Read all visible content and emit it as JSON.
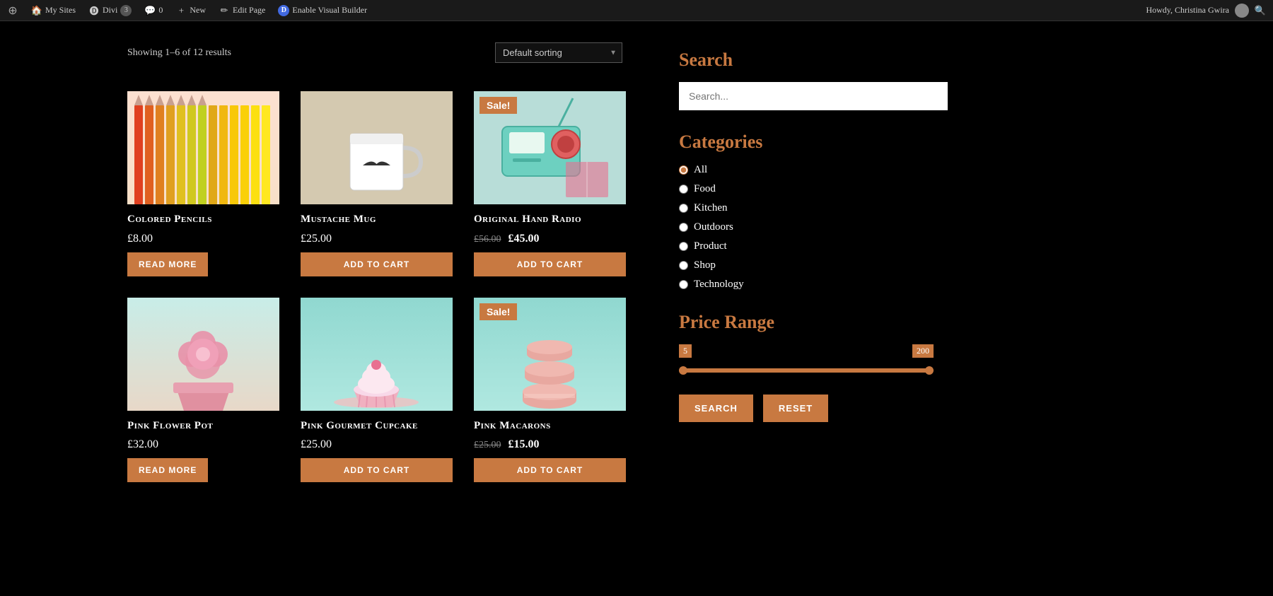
{
  "topbar": {
    "wp_label": "My Sites",
    "divi_label": "Divi",
    "divi_count": "3",
    "comments_count": "0",
    "new_label": "New",
    "edit_label": "Edit Page",
    "divi_builder_label": "Enable Visual Builder",
    "user_label": "Howdy, Christina Gwira"
  },
  "products": {
    "showing_text": "Showing 1–6 of 12 results",
    "sort_label": "Default sorting",
    "items": [
      {
        "id": "colored-pencils",
        "title": "Colored Pencils",
        "price": "£8.00",
        "original_price": null,
        "sale": false,
        "button": "READ MORE",
        "button_type": "readmore"
      },
      {
        "id": "mustache-mug",
        "title": "Mustache Mug",
        "price": "£25.00",
        "original_price": null,
        "sale": false,
        "button": "ADD TO CART",
        "button_type": "cart"
      },
      {
        "id": "original-hand-radio",
        "title": "Original Hand Radio",
        "price": "£45.00",
        "original_price": "£56.00",
        "sale": true,
        "sale_badge": "Sale!",
        "button": "ADD TO CART",
        "button_type": "cart"
      },
      {
        "id": "pink-flower-pot",
        "title": "Pink Flower Pot",
        "price": "£32.00",
        "original_price": null,
        "sale": false,
        "button": "READ MORE",
        "button_type": "readmore"
      },
      {
        "id": "pink-gourmet-cupcake",
        "title": "Pink Gourmet Cupcake",
        "price": "£25.00",
        "original_price": null,
        "sale": false,
        "button": "ADD TO CART",
        "button_type": "cart"
      },
      {
        "id": "pink-macarons",
        "title": "Pink Macarons",
        "price": "£15.00",
        "original_price": "£25.00",
        "sale": true,
        "sale_badge": "Sale!",
        "button": "ADD TO CART",
        "button_type": "cart"
      }
    ]
  },
  "sidebar": {
    "search_title": "Search",
    "search_placeholder": "Search...",
    "categories_title": "Categories",
    "categories": [
      {
        "label": "All",
        "checked": true
      },
      {
        "label": "Food",
        "checked": false
      },
      {
        "label": "Kitchen",
        "checked": false
      },
      {
        "label": "Outdoors",
        "checked": false
      },
      {
        "label": "Product",
        "checked": false
      },
      {
        "label": "Shop",
        "checked": false
      },
      {
        "label": "Technology",
        "checked": false
      }
    ],
    "price_range_title": "Price Range",
    "price_min": "5",
    "price_max": "200",
    "search_btn": "SEARCH",
    "reset_btn": "RESET"
  }
}
